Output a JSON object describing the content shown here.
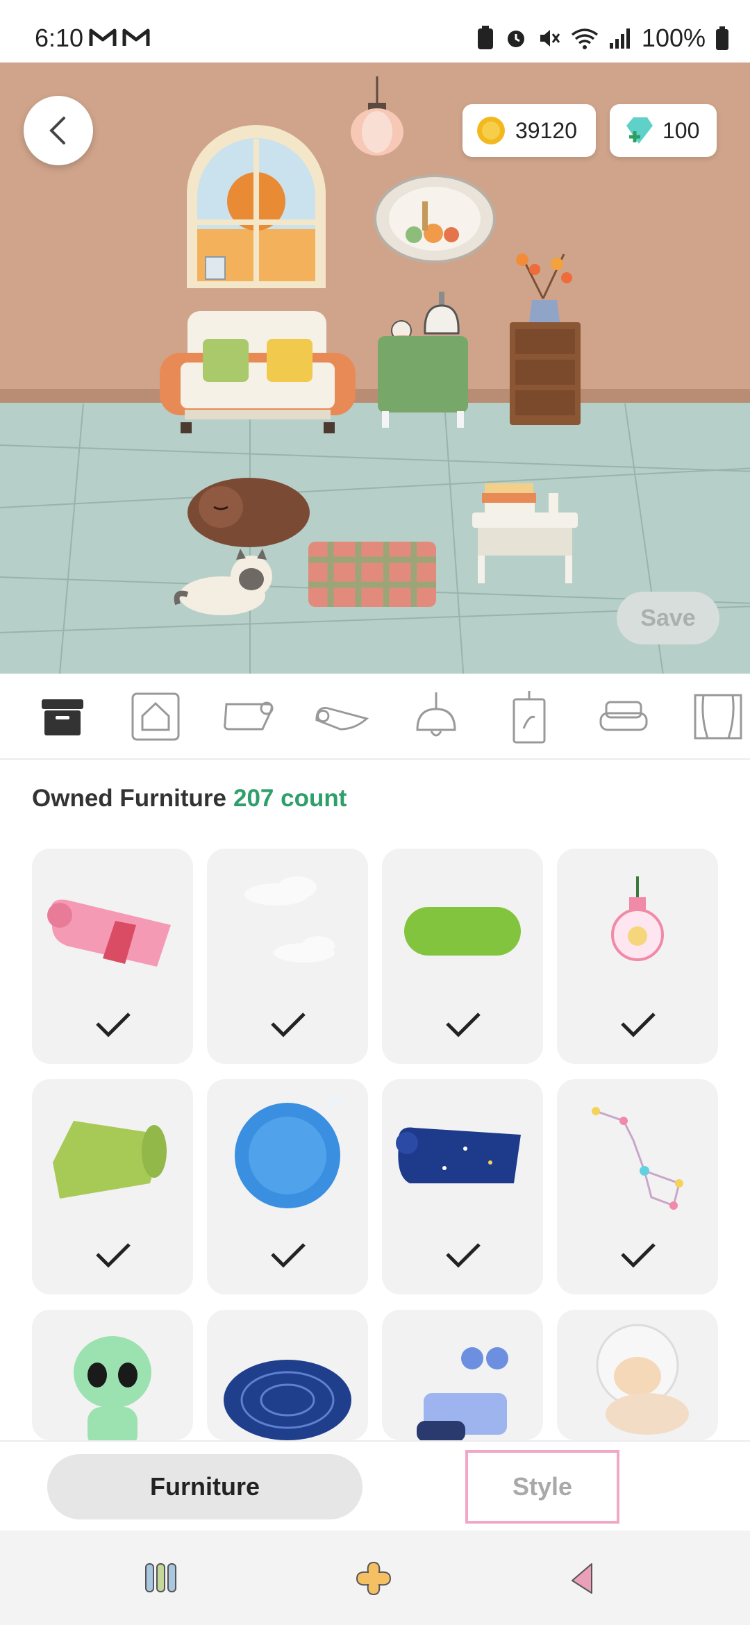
{
  "status_bar": {
    "time": "6:10",
    "battery": "100%"
  },
  "room": {
    "coins": "39120",
    "gems": "100",
    "save_label": "Save"
  },
  "categories": [
    {
      "name": "storage-box-icon",
      "active": true
    },
    {
      "name": "house-icon",
      "active": false
    },
    {
      "name": "wallpaper-icon",
      "active": false
    },
    {
      "name": "floor-rug-icon",
      "active": false
    },
    {
      "name": "ceiling-lamp-icon",
      "active": false
    },
    {
      "name": "wall-hanging-icon",
      "active": false
    },
    {
      "name": "sofa-icon",
      "active": false
    },
    {
      "name": "curtain-icon",
      "active": false
    }
  ],
  "owned": {
    "title": "Owned Furniture",
    "count": "207 count"
  },
  "items": [
    {
      "name": "pink-rug",
      "checked": true
    },
    {
      "name": "clouds",
      "checked": true
    },
    {
      "name": "grass-mat",
      "checked": true
    },
    {
      "name": "pink-bulb-lamp",
      "checked": true
    },
    {
      "name": "green-rug",
      "checked": true
    },
    {
      "name": "blue-planet-orb",
      "checked": true
    },
    {
      "name": "starry-navy-rug",
      "checked": true
    },
    {
      "name": "constellation",
      "checked": true
    },
    {
      "name": "alien-figure",
      "checked": false
    },
    {
      "name": "galaxy-rug",
      "checked": false
    },
    {
      "name": "robot-figure",
      "checked": false
    },
    {
      "name": "astronaut-cat",
      "checked": false
    }
  ],
  "tabs": {
    "furniture": "Furniture",
    "style": "Style"
  },
  "colors": {
    "accent_green": "#2e9f6a",
    "highlight_pink": "#f0a8c4"
  }
}
